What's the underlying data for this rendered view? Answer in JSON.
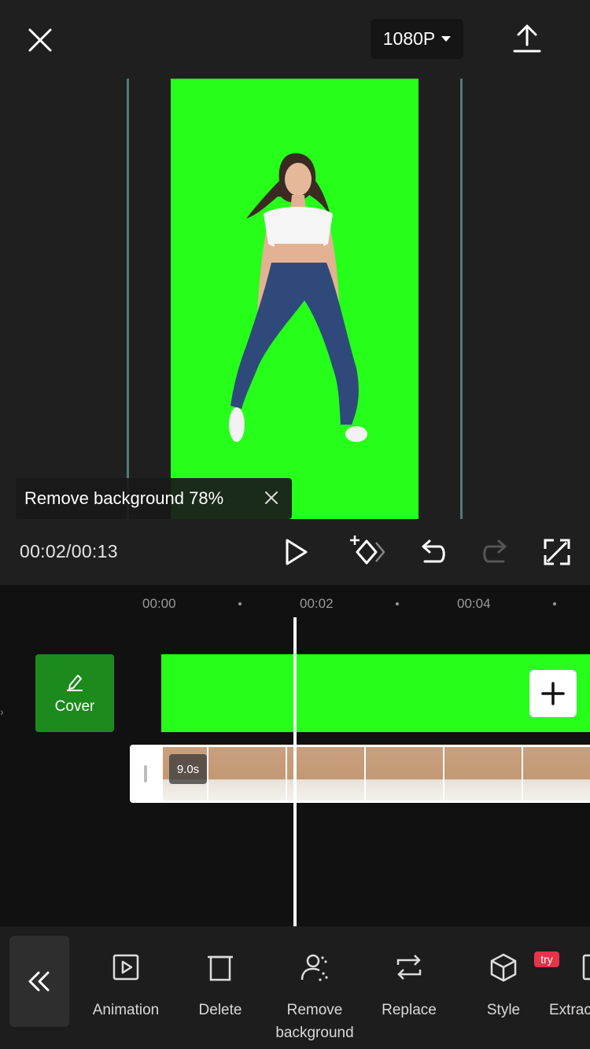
{
  "header": {
    "resolution": "1080P",
    "close_icon": "close-icon",
    "export_icon": "export-upload-icon"
  },
  "notification": {
    "text": "Remove background 78%",
    "progress_percent": 78
  },
  "playback": {
    "time": "00:02/00:13"
  },
  "ruler": {
    "labels": [
      "00:00",
      "00:02",
      "00:04"
    ]
  },
  "timeline": {
    "cover_label": "Cover",
    "clip_duration": "9.0s"
  },
  "toolbar": {
    "items": [
      {
        "label": "Animation",
        "icon": "animation-icon"
      },
      {
        "label": "Delete",
        "icon": "trash-icon"
      },
      {
        "label": "Remove background",
        "icon": "person-cutout-icon"
      },
      {
        "label": "Replace",
        "icon": "replace-icon"
      },
      {
        "label": "Style",
        "icon": "cube-icon",
        "badge": "try"
      },
      {
        "label": "Extrac",
        "icon": "extract-icon"
      }
    ]
  },
  "colors": {
    "chroma_green": "#26ff1a",
    "cover_green": "#1c8a1d",
    "badge_red": "#e8334b",
    "guide_line": "#4d7d76"
  }
}
